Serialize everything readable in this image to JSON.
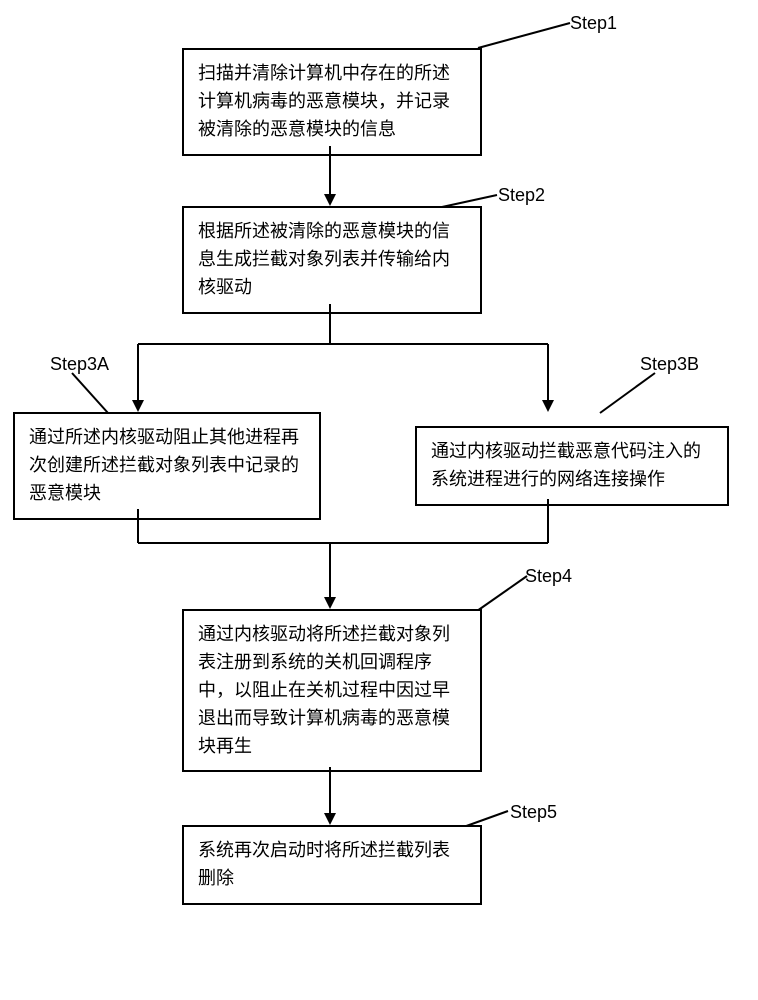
{
  "labels": {
    "step1": "Step1",
    "step2": "Step2",
    "step3a": "Step3A",
    "step3b": "Step3B",
    "step4": "Step4",
    "step5": "Step5"
  },
  "boxes": {
    "step1": "扫描并清除计算机中存在的所述计算机病毒的恶意模块，并记录被清除的恶意模块的信息",
    "step2": "根据所述被清除的恶意模块的信息生成拦截对象列表并传输给内核驱动",
    "step3a": "通过所述内核驱动阻止其他进程再次创建所述拦截对象列表中记录的恶意模块",
    "step3b": "通过内核驱动拦截恶意代码注入的系统进程进行的网络连接操作",
    "step4": "通过内核驱动将所述拦截对象列表注册到系统的关机回调程序中，以阻止在关机过程中因过早退出而导致计算机病毒的恶意模块再生",
    "step5": "系统再次启动时将所述拦截列表删除"
  }
}
